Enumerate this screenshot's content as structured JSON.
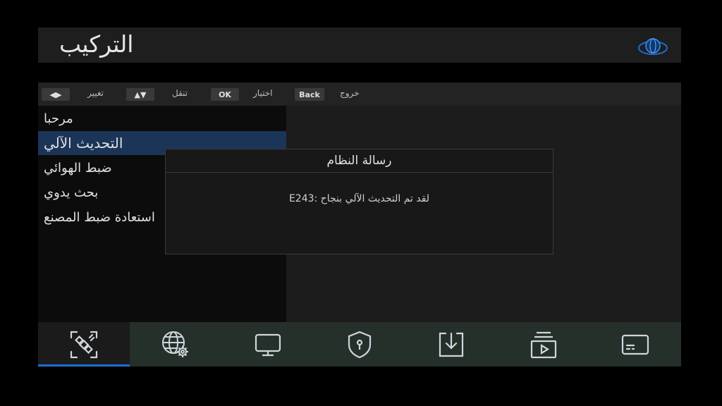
{
  "header": {
    "title": "التركيب",
    "logo_icon": "globe-logo-icon"
  },
  "hints": [
    {
      "key": "◀▶",
      "label": "تغيير"
    },
    {
      "key": "▲▼",
      "label": "تنقل"
    },
    {
      "key": "OK",
      "label": "اختيار"
    },
    {
      "key": "Back",
      "label": "خروج"
    }
  ],
  "menu": {
    "items": [
      {
        "label": "مرحبا"
      },
      {
        "label": "التحديث الآلي",
        "selected": true
      },
      {
        "label": "ضبط الهوائي"
      },
      {
        "label": "بحث يدوي"
      },
      {
        "label": "استعادة ضبط المصنع"
      }
    ]
  },
  "dialog": {
    "title": "رسالة النظام",
    "message": "E243: لقد تم التحديث الآلي بنجاح"
  },
  "tabs": [
    {
      "icon": "satellite-icon",
      "active": true
    },
    {
      "icon": "network-settings-icon"
    },
    {
      "icon": "tv-icon"
    },
    {
      "icon": "security-shield-icon"
    },
    {
      "icon": "download-icon"
    },
    {
      "icon": "media-playlist-icon"
    },
    {
      "icon": "subtitle-card-icon"
    }
  ],
  "colors": {
    "accent": "#1d6fd0",
    "selected_bg": "#1b3558",
    "tabbar_bg": "#26302b"
  }
}
